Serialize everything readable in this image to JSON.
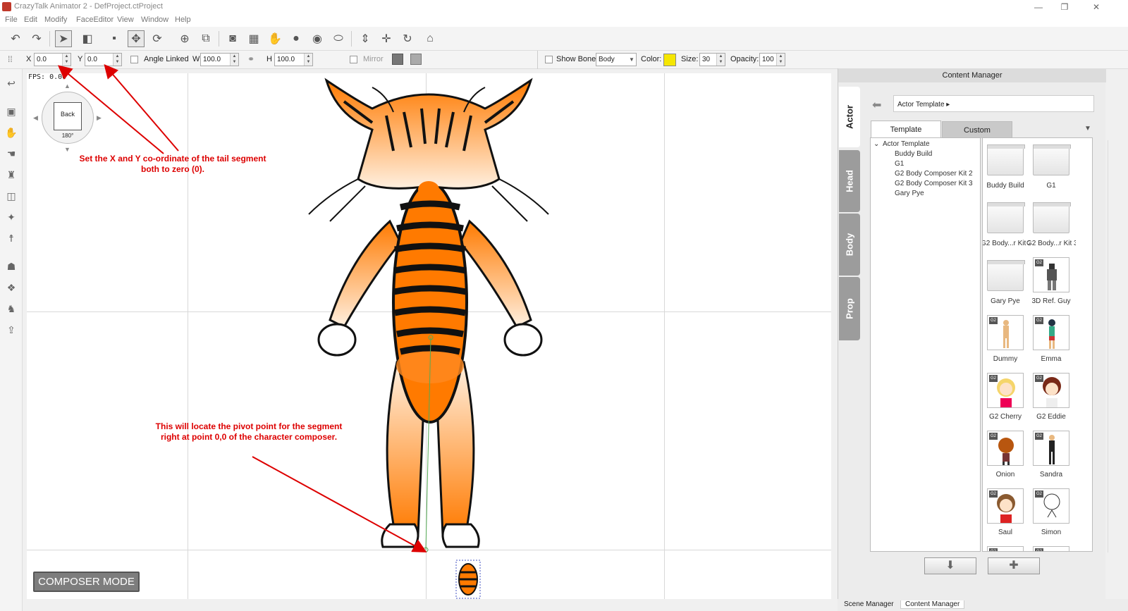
{
  "window": {
    "title": "CrazyTalk Animator 2  - DefProject.ctProject",
    "minimize": "—",
    "restore": "❐",
    "close": "✕"
  },
  "menu": [
    "File",
    "Edit",
    "Modify",
    "FaceEditor",
    "View",
    "Window",
    "Help"
  ],
  "properties": {
    "x_label": "X",
    "x_value": "0.0",
    "y_label": "Y",
    "y_value": "0.0",
    "angle_linked": "Angle Linked",
    "w_label": "W",
    "w_value": "100.0",
    "h_label": "H",
    "h_value": "100.0",
    "mirror": "Mirror",
    "show_bone": "Show Bone",
    "bone_mode": "Body",
    "color_label": "Color:",
    "color_value": "#f5e600",
    "size_label": "Size:",
    "size_value": "30",
    "opacity_label": "Opacity:",
    "opacity_value": "100"
  },
  "canvas": {
    "fps": "FPS: 0.00",
    "view_dial": {
      "label": "Back",
      "angle": "180°"
    },
    "composer_mode": "COMPOSER MODE",
    "annotation_1": [
      "Set the X and Y co-ordinate of the tail segment",
      "both to zero (0)."
    ],
    "annotation_2": [
      "This will locate the pivot point for the segment",
      "right at point 0,0 of the character composer."
    ]
  },
  "content_manager": {
    "title": "Content Manager",
    "side_tabs": [
      "Actor",
      "Head",
      "Body",
      "Prop"
    ],
    "breadcrumb": "Actor Template ▸",
    "tabs": [
      "Template",
      "Custom"
    ],
    "tree_root": "Actor Template",
    "tree_items": [
      "Buddy Build",
      "G1",
      "G2 Body Composer Kit 2",
      "G2 Body Composer Kit 3",
      "Gary Pye"
    ],
    "thumbnails": [
      {
        "label": "Buddy Build"
      },
      {
        "label": "G1"
      },
      {
        "label": "G2 Body...r Kit 2"
      },
      {
        "label": "G2 Body...r Kit 3"
      },
      {
        "label": "Gary Pye"
      },
      {
        "label": "3D Ref. Guy"
      },
      {
        "label": "Dummy"
      },
      {
        "label": "Emma"
      },
      {
        "label": "G2 Cherry"
      },
      {
        "label": "G2 Eddie"
      },
      {
        "label": "Onion"
      },
      {
        "label": "Sandra"
      },
      {
        "label": "Saul"
      },
      {
        "label": "Simon"
      }
    ],
    "btn_down": "⬇",
    "btn_add": "✚"
  },
  "bottom_tabs": [
    "Scene Manager",
    "Content Manager"
  ]
}
